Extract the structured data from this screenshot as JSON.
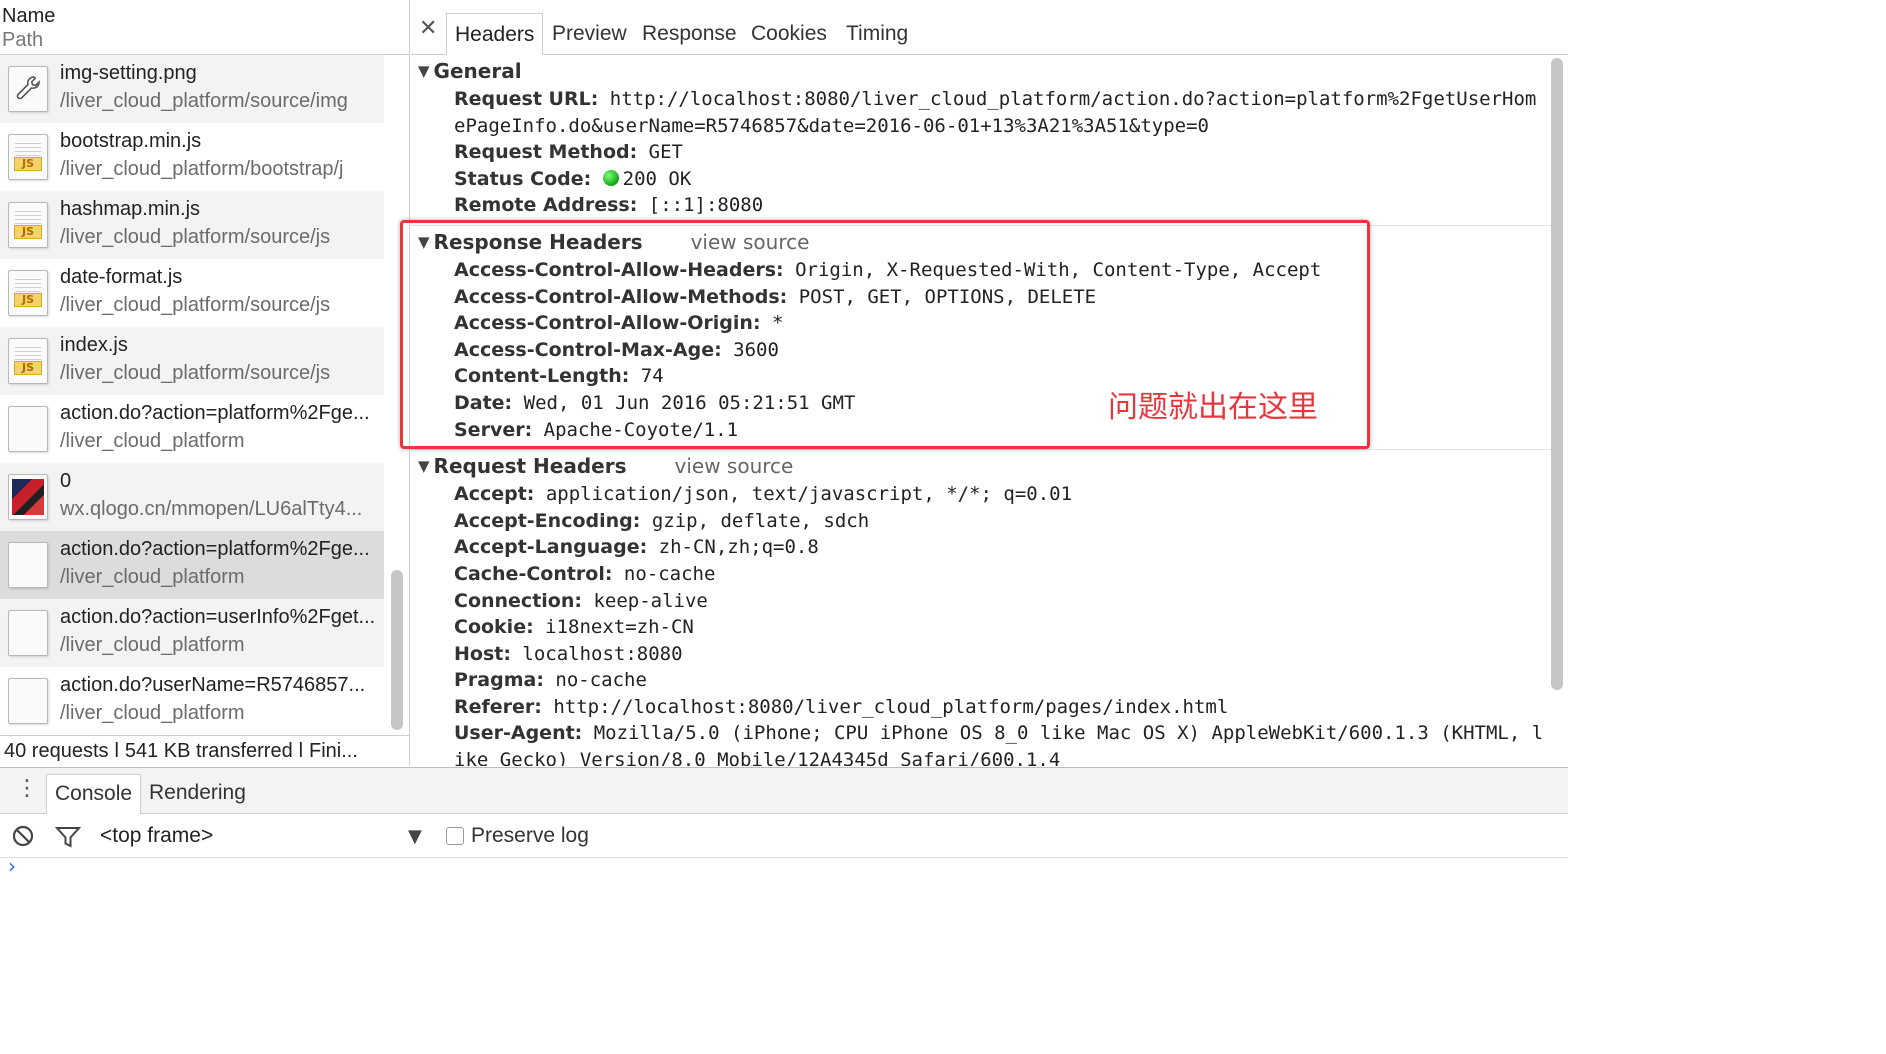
{
  "list": {
    "col_name": "Name",
    "col_path": "Path",
    "rows": [
      {
        "name": "img-setting.png",
        "path": "/liver_cloud_platform/source/img",
        "icon": "wrench-icon"
      },
      {
        "name": "bootstrap.min.js",
        "path": "/liver_cloud_platform/bootstrap/j",
        "icon": "js-file-icon"
      },
      {
        "name": "hashmap.min.js",
        "path": "/liver_cloud_platform/source/js",
        "icon": "js-file-icon"
      },
      {
        "name": "date-format.js",
        "path": "/liver_cloud_platform/source/js",
        "icon": "js-file-icon"
      },
      {
        "name": "index.js",
        "path": "/liver_cloud_platform/source/js",
        "icon": "js-file-icon"
      },
      {
        "name": "action.do?action=platform%2Fge...",
        "path": "/liver_cloud_platform",
        "icon": "blank-file-icon"
      },
      {
        "name": "0",
        "path": "wx.qlogo.cn/mmopen/LU6alTty4...",
        "icon": "image-thumbnail-icon"
      },
      {
        "name": "action.do?action=platform%2Fge...",
        "path": "/liver_cloud_platform",
        "icon": "blank-file-icon",
        "selected": true
      },
      {
        "name": "action.do?action=userInfo%2Fget...",
        "path": "/liver_cloud_platform",
        "icon": "blank-file-icon"
      },
      {
        "name": "action.do?userName=R5746857...",
        "path": "/liver_cloud_platform",
        "icon": "blank-file-icon"
      }
    ],
    "status": "40 requests  ǀ  541 KB transferred  ǀ  Fini..."
  },
  "tabs": [
    "Headers",
    "Preview",
    "Response",
    "Cookies",
    "Timing"
  ],
  "general": {
    "title": "General",
    "request_url_key": "Request URL:",
    "request_url": "http://localhost:8080/liver_cloud_platform/action.do?action=platform%2FgetUserHomePageInfo.do&userName=R5746857&date=2016-06-01+13%3A21%3A51&type=0",
    "request_method_key": "Request Method:",
    "request_method": "GET",
    "status_code_key": "Status Code:",
    "status_code": "200 OK",
    "remote_address_key": "Remote Address:",
    "remote_address": "[::1]:8080"
  },
  "response_headers": {
    "title": "Response Headers",
    "view_source": "view source",
    "items": [
      {
        "k": "Access-Control-Allow-Headers:",
        "v": "Origin, X-Requested-With, Content-Type, Accept"
      },
      {
        "k": "Access-Control-Allow-Methods:",
        "v": "POST, GET, OPTIONS, DELETE"
      },
      {
        "k": "Access-Control-Allow-Origin:",
        "v": "*"
      },
      {
        "k": "Access-Control-Max-Age:",
        "v": "3600"
      },
      {
        "k": "Content-Length:",
        "v": "74"
      },
      {
        "k": "Date:",
        "v": "Wed, 01 Jun 2016 05:21:51 GMT"
      },
      {
        "k": "Server:",
        "v": "Apache-Coyote/1.1"
      }
    ]
  },
  "request_headers": {
    "title": "Request Headers",
    "view_source": "view source",
    "items": [
      {
        "k": "Accept:",
        "v": "application/json, text/javascript, */*; q=0.01"
      },
      {
        "k": "Accept-Encoding:",
        "v": "gzip, deflate, sdch"
      },
      {
        "k": "Accept-Language:",
        "v": "zh-CN,zh;q=0.8"
      },
      {
        "k": "Cache-Control:",
        "v": "no-cache"
      },
      {
        "k": "Connection:",
        "v": "keep-alive"
      },
      {
        "k": "Cookie:",
        "v": "i18next=zh-CN"
      },
      {
        "k": "Host:",
        "v": "localhost:8080"
      },
      {
        "k": "Pragma:",
        "v": "no-cache"
      },
      {
        "k": "Referer:",
        "v": "http://localhost:8080/liver_cloud_platform/pages/index.html"
      },
      {
        "k": "User-Agent:",
        "v": "Mozilla/5.0 (iPhone; CPU iPhone OS 8_0 like Mac OS X) AppleWebKit/600.1.3 (KHTML, like Gecko) Version/8.0 Mobile/12A4345d Safari/600.1.4"
      }
    ]
  },
  "annotation": "问题就出在这里",
  "drawer": {
    "tabs": [
      "Console",
      "Rendering"
    ],
    "frame": "<top frame>",
    "preserve_log": "Preserve log"
  },
  "colors": {
    "annotation": "#e8363f",
    "status_ok": "#0fa50f",
    "prompt": "#2d6be4"
  }
}
